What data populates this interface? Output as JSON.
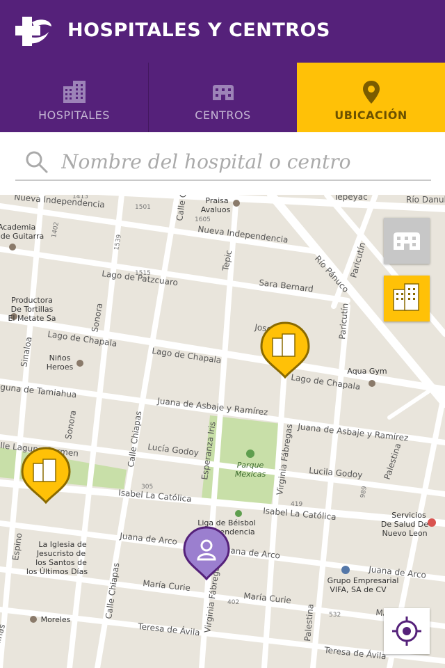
{
  "app": {
    "title": "HOSPITALES Y CENTROS",
    "logo_icon": "medical-cross-logo-icon"
  },
  "tabs": [
    {
      "label": "HOSPITALES",
      "icon": "hospital-buildings-icon",
      "selected": false
    },
    {
      "label": "CENTROS",
      "icon": "center-building-icon",
      "selected": false
    },
    {
      "label": "UBICACIÓN",
      "icon": "location-pin-icon",
      "selected": true
    }
  ],
  "search": {
    "placeholder": "Nombre del hospital o centro",
    "value": ""
  },
  "colors": {
    "brand": "#55217a",
    "accent": "#ffc107",
    "map_bg": "#e9e5dc",
    "park": "#c8dfa8",
    "user_marker": "#9b7fcf"
  },
  "map": {
    "streets": {
      "nueva_independencia_1": "Nueva Independencia",
      "nueva_independencia_2": "Nueva Independencia",
      "lago_patzcuaro": "Lago de Patzcuaro",
      "sara_bernard": "Sara Bernard",
      "rio_panuco": "Río Pánuco",
      "paricutin_1": "Paricutín",
      "paricutin_2": "Paricutín",
      "lago_chapala_1": "Lago de Chapala",
      "lago_chapala_2": "Lago de Chapala",
      "lago_chapala_3": "Lago de Chapala",
      "jose": "Jose",
      "tepic": "Tepic",
      "calle_c": "Calle C",
      "sonora_1": "Sonora",
      "sonora_2": "Sonora",
      "sinaloa": "Sinaloa",
      "laguna_tamiahua": "guna de Tamiahua",
      "juana_asbaje_1": "Juana de Asbaje y Ramírez",
      "juana_asbaje_2": "Juana de Asbaje y Ramírez",
      "lucia_godoy_1": "Lucía Godoy",
      "lucila_godoy": "Lucila Godoy",
      "esperanza_iris": "Esperanza Iris",
      "virginia_fabregas_1": "Virginia Fábregas",
      "virginia_fabregas_2": "Virginia Fábregas",
      "calle_chiapas_1": "Calle Chiapas",
      "calle_chiapas_2": "Calle Chiapas",
      "laguna_carmen": "lle Laguna Carmen",
      "isabel_catolica_1": "Isabel La Católica",
      "isabel_catolica_2": "Isabel La Católica",
      "juana_arco_1": "Juana de Arco",
      "juana_arco_2": "Juana de Arco",
      "juana_arco_3": "Juana de Arco",
      "maria_curie_1": "María Curie",
      "maria_curie_2": "María Curie",
      "maria_curie_3": "María Curie",
      "teresa_avila_1": "Teresa de Ávila",
      "teresa_avila_2": "Teresa de Ávila",
      "palestina_1": "Palestina",
      "palestina_2": "Palestina",
      "espino": "Espino",
      "tepeyac": "Tepeyac",
      "danubio": "Río Danub",
      "linas": "linas"
    },
    "places": {
      "academia": "Academia\nde Guitarra",
      "praisa": "Praisa\nAvaluos",
      "productora": "Productora\nDe Tortillas\nEl Metate Sa",
      "ninos_heroes": "Niños\nHeroes",
      "aqua_gym": "Aqua Gym",
      "parque_mexicas": "Parque\nMexicas",
      "liga_beisbol": "Liga de Béisbol\nIndependencia",
      "servicios_salud": "Servicios\nDe Salud De\nNuevo Leon",
      "iglesia": "La Iglesia de\nJesucristo de\nlos Santos de\nlos Últimos Días",
      "grupo_empresarial": "Grupo Empresarial\nVIFA, SA de CV",
      "moreles": "Moreles"
    },
    "numbers": [
      "1413",
      "1501",
      "1605",
      "1402",
      "1539",
      "1515",
      "305",
      "419",
      "989",
      "402",
      "532"
    ],
    "markers": [
      {
        "type": "hospital",
        "icon": "hospital-marker-icon"
      },
      {
        "type": "hospital",
        "icon": "hospital-marker-icon"
      },
      {
        "type": "user",
        "icon": "user-location-marker-icon"
      }
    ],
    "controls": {
      "centers_filter": {
        "icon": "center-building-icon",
        "active": false
      },
      "hospitals_filter": {
        "icon": "hospital-buildings-icon",
        "active": true
      },
      "my_location": {
        "icon": "crosshair-target-icon"
      }
    }
  }
}
